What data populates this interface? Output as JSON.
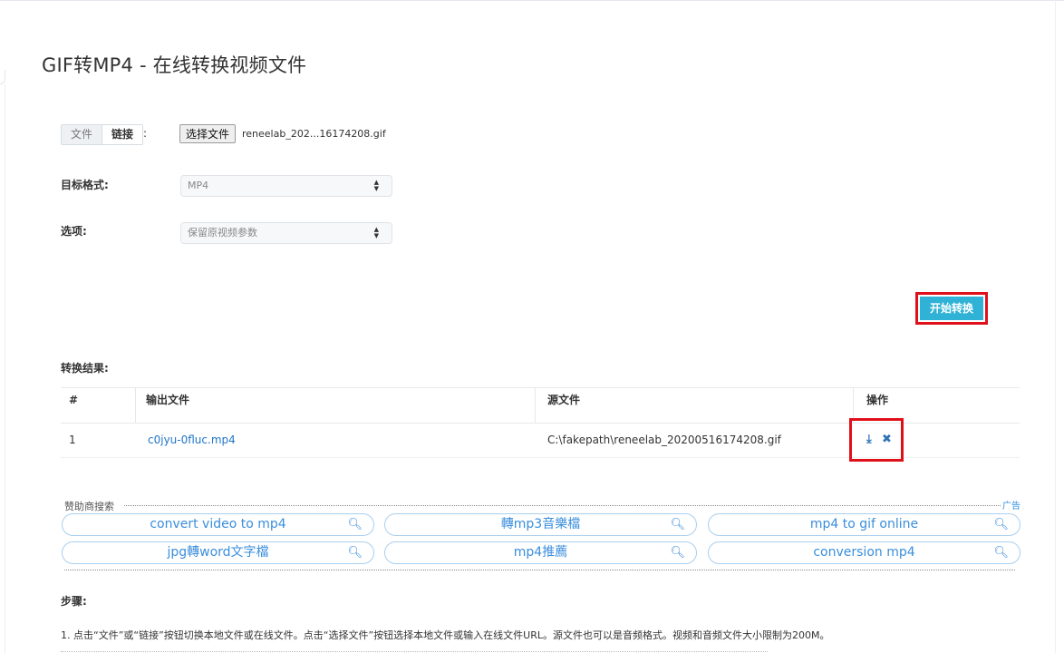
{
  "page": {
    "title": "GIF转MP4 - 在线转换视频文件"
  },
  "source": {
    "tab_file": "文件",
    "tab_link": "链接",
    "colon": ":",
    "choose_button": "选择文件",
    "file_name": "reneelab_202...16174208.gif"
  },
  "format": {
    "label": "目标格式:",
    "value": "MP4"
  },
  "options": {
    "label": "选项:",
    "value": "保留原视频参数"
  },
  "actions": {
    "start_label": "开始转换"
  },
  "results": {
    "label": "转换结果:",
    "columns": [
      "#",
      "输出文件",
      "源文件",
      "操作"
    ],
    "rows": [
      {
        "index": "1",
        "output": "c0jyu-0fluc.mp4",
        "source": "C:\\fakepath\\reneelab_20200516174208.gif",
        "icons": [
          "download-icon",
          "close-icon"
        ]
      }
    ]
  },
  "sponsor": {
    "label": "赞助商搜索",
    "ad_label": "广告",
    "searches": [
      "convert video to mp4",
      "轉mp3音樂檔",
      "mp4 to gif online",
      "jpg轉word文字檔",
      "mp4推薦",
      "conversion mp4"
    ]
  },
  "steps": {
    "label": "步骤:",
    "step1": "1. 点击“文件”或“链接”按钮切换本地文件或在线文件。点击“选择文件”按钮选择本地文件或输入在线文件URL。源文件也可以是音频格式。视频和音频文件大小限制为200M。"
  },
  "colors": {
    "accent": "#2fb2d6",
    "highlight": "#e0101a",
    "link": "#2176c7"
  }
}
